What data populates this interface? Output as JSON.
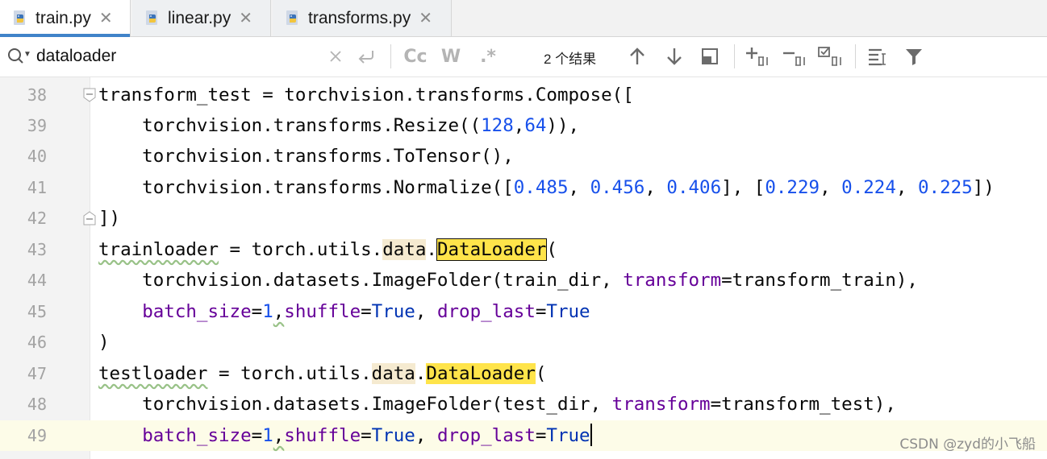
{
  "tabs": [
    {
      "label": "train.py",
      "active": true
    },
    {
      "label": "linear.py",
      "active": false
    },
    {
      "label": "transforms.py",
      "active": false
    }
  ],
  "find": {
    "query": "dataloader",
    "match_case_label": "Cc",
    "words_label": "W",
    "regex_label": ".*",
    "result_count": "2 个结果"
  },
  "gutter": {
    "line_numbers": [
      "38",
      "39",
      "40",
      "41",
      "42",
      "43",
      "44",
      "45",
      "46",
      "47",
      "48",
      "49"
    ]
  },
  "code": {
    "l38": {
      "a": "transform_test = torchvision.transforms.Compose(["
    },
    "l39": {
      "a": "    torchvision.transforms.Resize((",
      "n1": "128",
      "c": ",",
      "n2": "64",
      "b": ")),"
    },
    "l40": {
      "a": "    torchvision.transforms.ToTensor(),"
    },
    "l41": {
      "a": "    torchvision.transforms.Normalize([",
      "n1": "0.485",
      "s1": ", ",
      "n2": "0.456",
      "s2": ", ",
      "n3": "0.406",
      "s3": "], [",
      "n4": "0.229",
      "s4": ", ",
      "n5": "0.224",
      "s5": ", ",
      "n6": "0.225",
      "e": "])"
    },
    "l42": {
      "a": "])"
    },
    "l43": {
      "var": "trainloader",
      "a": " = torch.utils.",
      "data": "data",
      "dot": ".",
      "match": "DataLoader",
      "e": "("
    },
    "l44": {
      "a": "    torchvision.datasets.ImageFolder(train_dir, ",
      "kw": "transform",
      "b": "=transform_train),"
    },
    "l45": {
      "ind": "    ",
      "k1": "batch_size",
      "eq1": "=",
      "n": "1",
      "c": ",",
      "k2": "shuffle",
      "eq2": "=",
      "v2": "True",
      "s": ", ",
      "k3": "drop_last",
      "eq3": "=",
      "v3": "True"
    },
    "l46": {
      "a": ")"
    },
    "l47": {
      "var": "testloader",
      "a": " = torch.utils.",
      "data": "data",
      "dot": ".",
      "match": "DataLoader",
      "e": "("
    },
    "l48": {
      "a": "    torchvision.datasets.ImageFolder(test_dir, ",
      "kw": "transform",
      "b": "=transform_test),"
    },
    "l49": {
      "ind": "    ",
      "k1": "batch_size",
      "eq1": "=",
      "n": "1",
      "c": ",",
      "k2": "shuffle",
      "eq2": "=",
      "v2": "True",
      "s": ", ",
      "k3": "drop_last",
      "eq3": "=",
      "v3": "True"
    }
  },
  "watermark": "CSDN @zyd的小飞船",
  "colors": {
    "keyword": "#0033b3",
    "number": "#1750eb",
    "keyword_arg": "#660099",
    "search_match": "#ffe44a",
    "tab_accent": "#4083c9"
  }
}
